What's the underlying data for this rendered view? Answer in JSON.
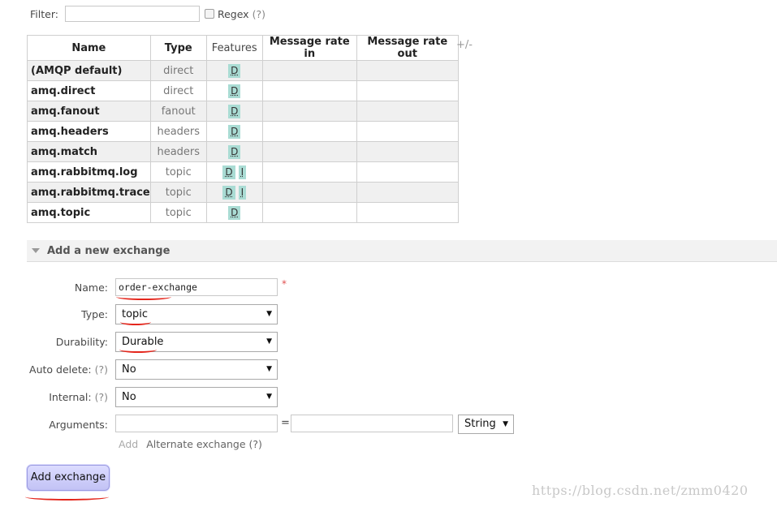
{
  "filter": {
    "label": "Filter:",
    "regex_label": "Regex",
    "regex_help": "(?)"
  },
  "table": {
    "headers": [
      "Name",
      "Type",
      "Features",
      "Message rate in",
      "Message rate out"
    ],
    "toggle_columns": "+/-",
    "rows": [
      {
        "name": "(AMQP default)",
        "type": "direct",
        "features": [
          "D"
        ]
      },
      {
        "name": "amq.direct",
        "type": "direct",
        "features": [
          "D"
        ]
      },
      {
        "name": "amq.fanout",
        "type": "fanout",
        "features": [
          "D"
        ]
      },
      {
        "name": "amq.headers",
        "type": "headers",
        "features": [
          "D"
        ]
      },
      {
        "name": "amq.match",
        "type": "headers",
        "features": [
          "D"
        ]
      },
      {
        "name": "amq.rabbitmq.log",
        "type": "topic",
        "features": [
          "D",
          "I"
        ]
      },
      {
        "name": "amq.rabbitmq.trace",
        "type": "topic",
        "features": [
          "D",
          "I"
        ]
      },
      {
        "name": "amq.topic",
        "type": "topic",
        "features": [
          "D"
        ]
      }
    ]
  },
  "add_exchange_section": {
    "title": "Add a new exchange",
    "name_label": "Name:",
    "name_value": "order-exchange",
    "required_mark": "*",
    "type_label": "Type:",
    "type_value": "topic",
    "durability_label": "Durability:",
    "durability_value": "Durable",
    "auto_delete_label": "Auto delete:",
    "auto_delete_value": "No",
    "internal_label": "Internal:",
    "internal_value": "No",
    "help": "(?)",
    "arguments_label": "Arguments:",
    "equals": "=",
    "arg_type_value": "String",
    "add_link": "Add",
    "alternate_exchange": "Alternate exchange (?)",
    "submit_label": "Add exchange"
  },
  "watermark": "https://blog.csdn.net/zmm0420",
  "colors": {
    "badge": "#aadcd4",
    "button": "#c8c8f8",
    "annotation": "#e4261c"
  }
}
